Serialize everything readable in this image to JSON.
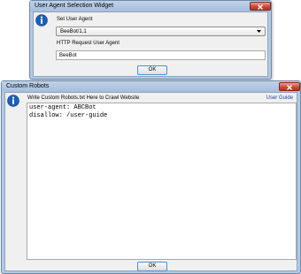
{
  "user_agent_dialog": {
    "title": "User Agent Selection Widget",
    "set_label": "Set User Agent",
    "selected_agent": "BeeBot/1.1",
    "http_label": "HTTP Request User Agent",
    "http_value": "BeeBot",
    "ok_label": "OK"
  },
  "custom_robots_dialog": {
    "title": "Custom Robots",
    "instruction": "Write Custom Robots.txt Here to Crawl Website",
    "user_guide_link": "User Guide",
    "editor_lines": [
      "user-agent: ABCBot",
      "disallow: /user-guide"
    ],
    "ok_label": "OK"
  },
  "icons": {
    "info": "info-icon",
    "close": "close-icon",
    "dropdown": "chevron-down-icon"
  },
  "colors": {
    "title_bar": "#b3c9e2",
    "close_button": "#c94a33",
    "info_icon": "#1d5fb5",
    "link": "#1f3fa8",
    "button_border": "#4d8fd0"
  }
}
